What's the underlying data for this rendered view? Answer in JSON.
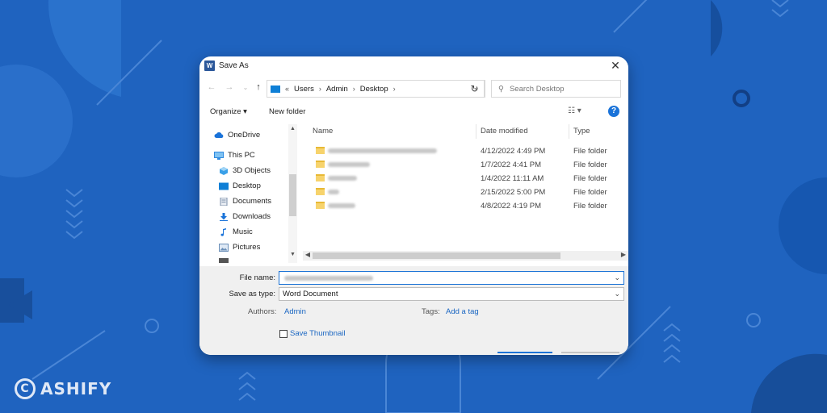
{
  "dialog": {
    "title": "Save As",
    "close_glyph": "✕"
  },
  "nav": {
    "back": "←",
    "forward": "→",
    "up": "↑",
    "recent": "⌄",
    "breadcrumb_prefix": "«",
    "breadcrumb": [
      "Users",
      "Admin",
      "Desktop"
    ],
    "crumb_sep": "›",
    "refresh": "↻",
    "search_placeholder": "Search Desktop"
  },
  "toolbar": {
    "organize": "Organize ▾",
    "new_folder": "New folder",
    "view_glyph": "☷ ▾",
    "help": "?"
  },
  "sidebar": {
    "items": [
      {
        "label": "OneDrive",
        "icon": "cloud-icon",
        "color": "#1a73d9"
      },
      {
        "label": "This PC",
        "icon": "computer-icon",
        "color": "#2f8ae0"
      },
      {
        "label": "3D Objects",
        "icon": "cube-icon",
        "color": "#3aa0e8"
      },
      {
        "label": "Desktop",
        "icon": "desktop-icon",
        "color": "#0f7fd6"
      },
      {
        "label": "Documents",
        "icon": "document-icon",
        "color": "#7a8ea8"
      },
      {
        "label": "Downloads",
        "icon": "download-icon",
        "color": "#1a73d9"
      },
      {
        "label": "Music",
        "icon": "music-icon",
        "color": "#1a73d9"
      },
      {
        "label": "Pictures",
        "icon": "picture-icon",
        "color": "#6b8fb8"
      }
    ]
  },
  "columns": {
    "name": "Name",
    "date_modified": "Date modified",
    "type": "Type"
  },
  "files": [
    {
      "date": "4/12/2022 4:49 PM",
      "type": "File folder"
    },
    {
      "date": "1/7/2022 4:41 PM",
      "type": "File folder"
    },
    {
      "date": "1/4/2022 11:11 AM",
      "type": "File folder"
    },
    {
      "date": "2/15/2022 5:00 PM",
      "type": "File folder"
    },
    {
      "date": "4/8/2022 4:19 PM",
      "type": "File folder"
    }
  ],
  "form": {
    "file_name_label": "File name:",
    "save_type_label": "Save as type:",
    "save_type_value": "Word Document",
    "authors_label": "Authors:",
    "authors_value": "Admin",
    "tags_label": "Tags:",
    "tags_value": "Add a tag",
    "thumbnail_label": "Save Thumbnail"
  },
  "brand": {
    "logo_glyph": "C",
    "name": "ASHIFY"
  },
  "colors": {
    "background": "#1f63bf",
    "accent": "#1a73d9"
  }
}
